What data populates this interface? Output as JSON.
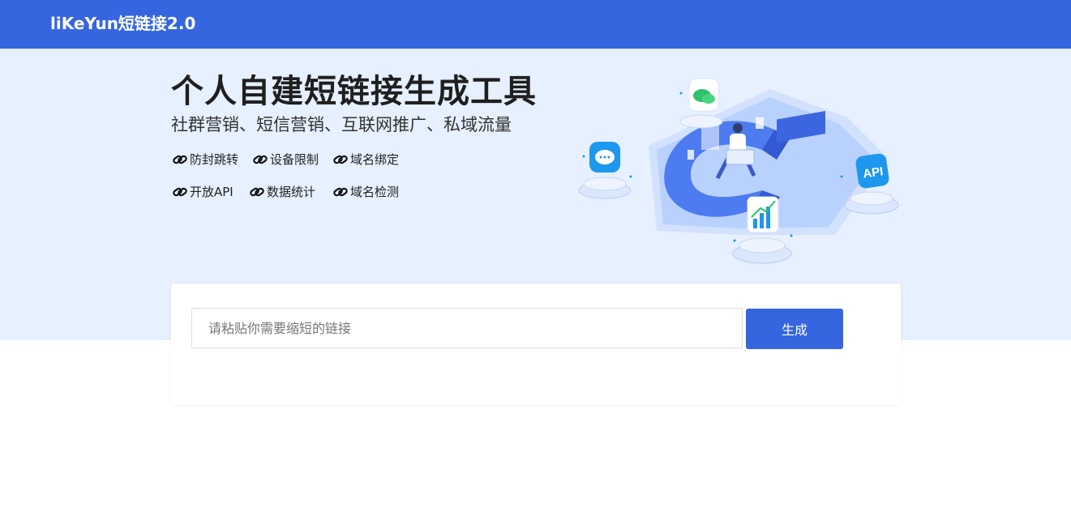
{
  "header": {
    "brand": "liKeYun短链接2.0"
  },
  "hero": {
    "title": "个人自建短链接生成工具",
    "subtitle": "社群营销、短信营销、互联网推广、私域流量",
    "features": [
      {
        "label": "防封跳转",
        "icon": "link-icon"
      },
      {
        "label": "设备限制",
        "icon": "link-icon"
      },
      {
        "label": "域名绑定",
        "icon": "link-icon"
      },
      {
        "label": "开放API",
        "icon": "link-icon"
      },
      {
        "label": "数据统计",
        "icon": "link-icon"
      },
      {
        "label": "域名检测",
        "icon": "link-icon"
      }
    ],
    "illustration_badges": {
      "api": "API"
    }
  },
  "form": {
    "input_placeholder": "请粘贴你需要缩短的链接",
    "input_value": "",
    "submit_label": "生成"
  },
  "colors": {
    "brand_blue": "#3566e0",
    "hero_bg": "#e6f0fe",
    "page_bg": "#ffffff"
  }
}
